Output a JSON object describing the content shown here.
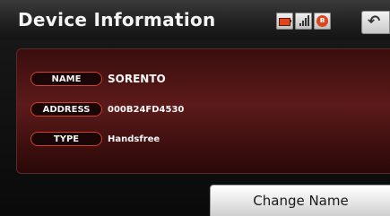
{
  "header": {
    "title": "Device Information",
    "status_icons": [
      "battery-icon",
      "signal-icon",
      "bluetooth-icon"
    ],
    "back_icon": "back-arrow-icon"
  },
  "info": {
    "rows": [
      {
        "label": "NAME",
        "value": "SORENTO"
      },
      {
        "label": "ADDRESS",
        "value": "000B24FD4530"
      },
      {
        "label": "TYPE",
        "value": "Handsfree"
      }
    ]
  },
  "actions": {
    "change_name_label": "Change Name"
  },
  "colors": {
    "accent": "#d0402a",
    "panel": "#4a1414",
    "header": "#2a2a2a"
  }
}
